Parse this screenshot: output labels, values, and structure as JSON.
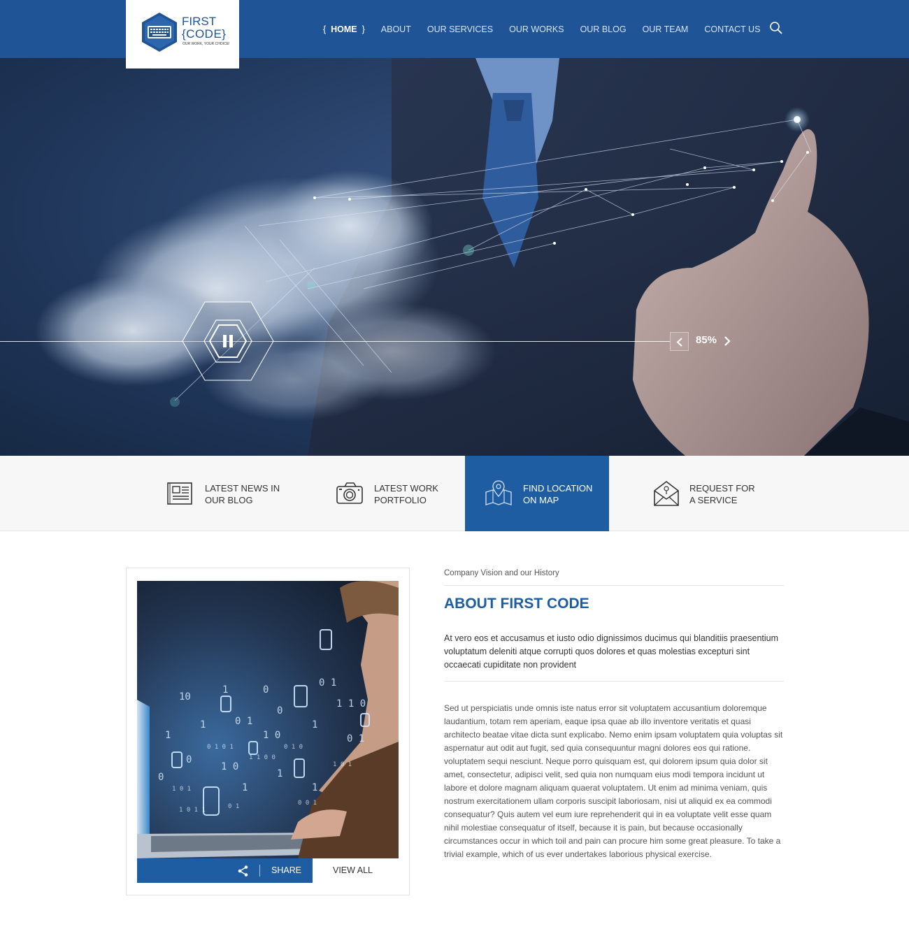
{
  "brand": {
    "name_line1": "FIRST",
    "name_line2": "{CODE}",
    "tagline": "OUR WORK, YOUR CHOICE!",
    "color_primary": "#1f5497",
    "color_accent": "#1f5da2"
  },
  "nav": {
    "items": [
      {
        "label": "HOME",
        "active": true
      },
      {
        "label": "ABOUT",
        "active": false
      },
      {
        "label": "OUR SERVICES",
        "active": false
      },
      {
        "label": "OUR WORKS",
        "active": false
      },
      {
        "label": "OUR BLOG",
        "active": false
      },
      {
        "label": "OUR TEAM",
        "active": false
      },
      {
        "label": "CONTACT US",
        "active": false
      }
    ],
    "active_open": "{",
    "active_close": "}",
    "search_icon": "search-icon"
  },
  "hero": {
    "progress_label": "85%",
    "progress_value": 0.85,
    "pause_icon": "pause-icon",
    "prev_icon": "chevron-left-icon",
    "next_icon": "chevron-right-icon"
  },
  "features": [
    {
      "label": "LATEST NEWS IN\nOUR BLOG",
      "icon": "newspaper-icon",
      "active": false
    },
    {
      "label": "LATEST WORK\nPORTFOLIO",
      "icon": "camera-icon",
      "active": false
    },
    {
      "label": "FIND LOCATION\nON MAP",
      "icon": "map-pin-icon",
      "active": true
    },
    {
      "label": "REQUEST FOR\nA SERVICE",
      "icon": "envelope-icon",
      "active": false
    }
  ],
  "about": {
    "eyebrow": "Company Vision and our History",
    "heading_light": "ABOUT",
    "heading_strong": "FIRST CODE",
    "lead": "At vero eos et accusamus et iusto odio dignissimos ducimus qui blanditiis praesentium voluptatum deleniti atque corrupti quos dolores et quas molestias excepturi sint occaecati cupiditate non provident",
    "body": "Sed ut perspiciatis unde omnis iste natus error sit voluptatem accusantium doloremque laudantium, totam rem aperiam, eaque ipsa quae ab illo inventore veritatis et quasi architecto beatae vitae dicta sunt explicabo. Nemo enim ipsam voluptatem quia voluptas sit aspernatur aut odit aut fugit, sed quia consequuntur magni dolores eos qui ratione. voluptatem sequi nesciunt. Neque porro quisquam est, qui dolorem ipsum quia dolor sit amet, consectetur, adipisci velit, sed quia non numquam eius modi tempora incidunt ut labore et dolore magnam aliquam quaerat voluptatem. Ut enim ad minima veniam, quis nostrum exercitationem ullam corporis suscipit laboriosam, nisi ut aliquid ex ea commodi consequatur? Quis autem vel eum iure reprehenderit qui in ea voluptate velit esse quam nihil molestiae consequatur of itself, because it is pain, but because occasionally circumstances occur in which toil and pain can procure him some great pleasure. To take a trivial example, which of us ever undertakes laborious physical exercise.",
    "share_label": "SHARE",
    "share_icon": "share-icon",
    "view_all_label": "VIEW ALL"
  }
}
